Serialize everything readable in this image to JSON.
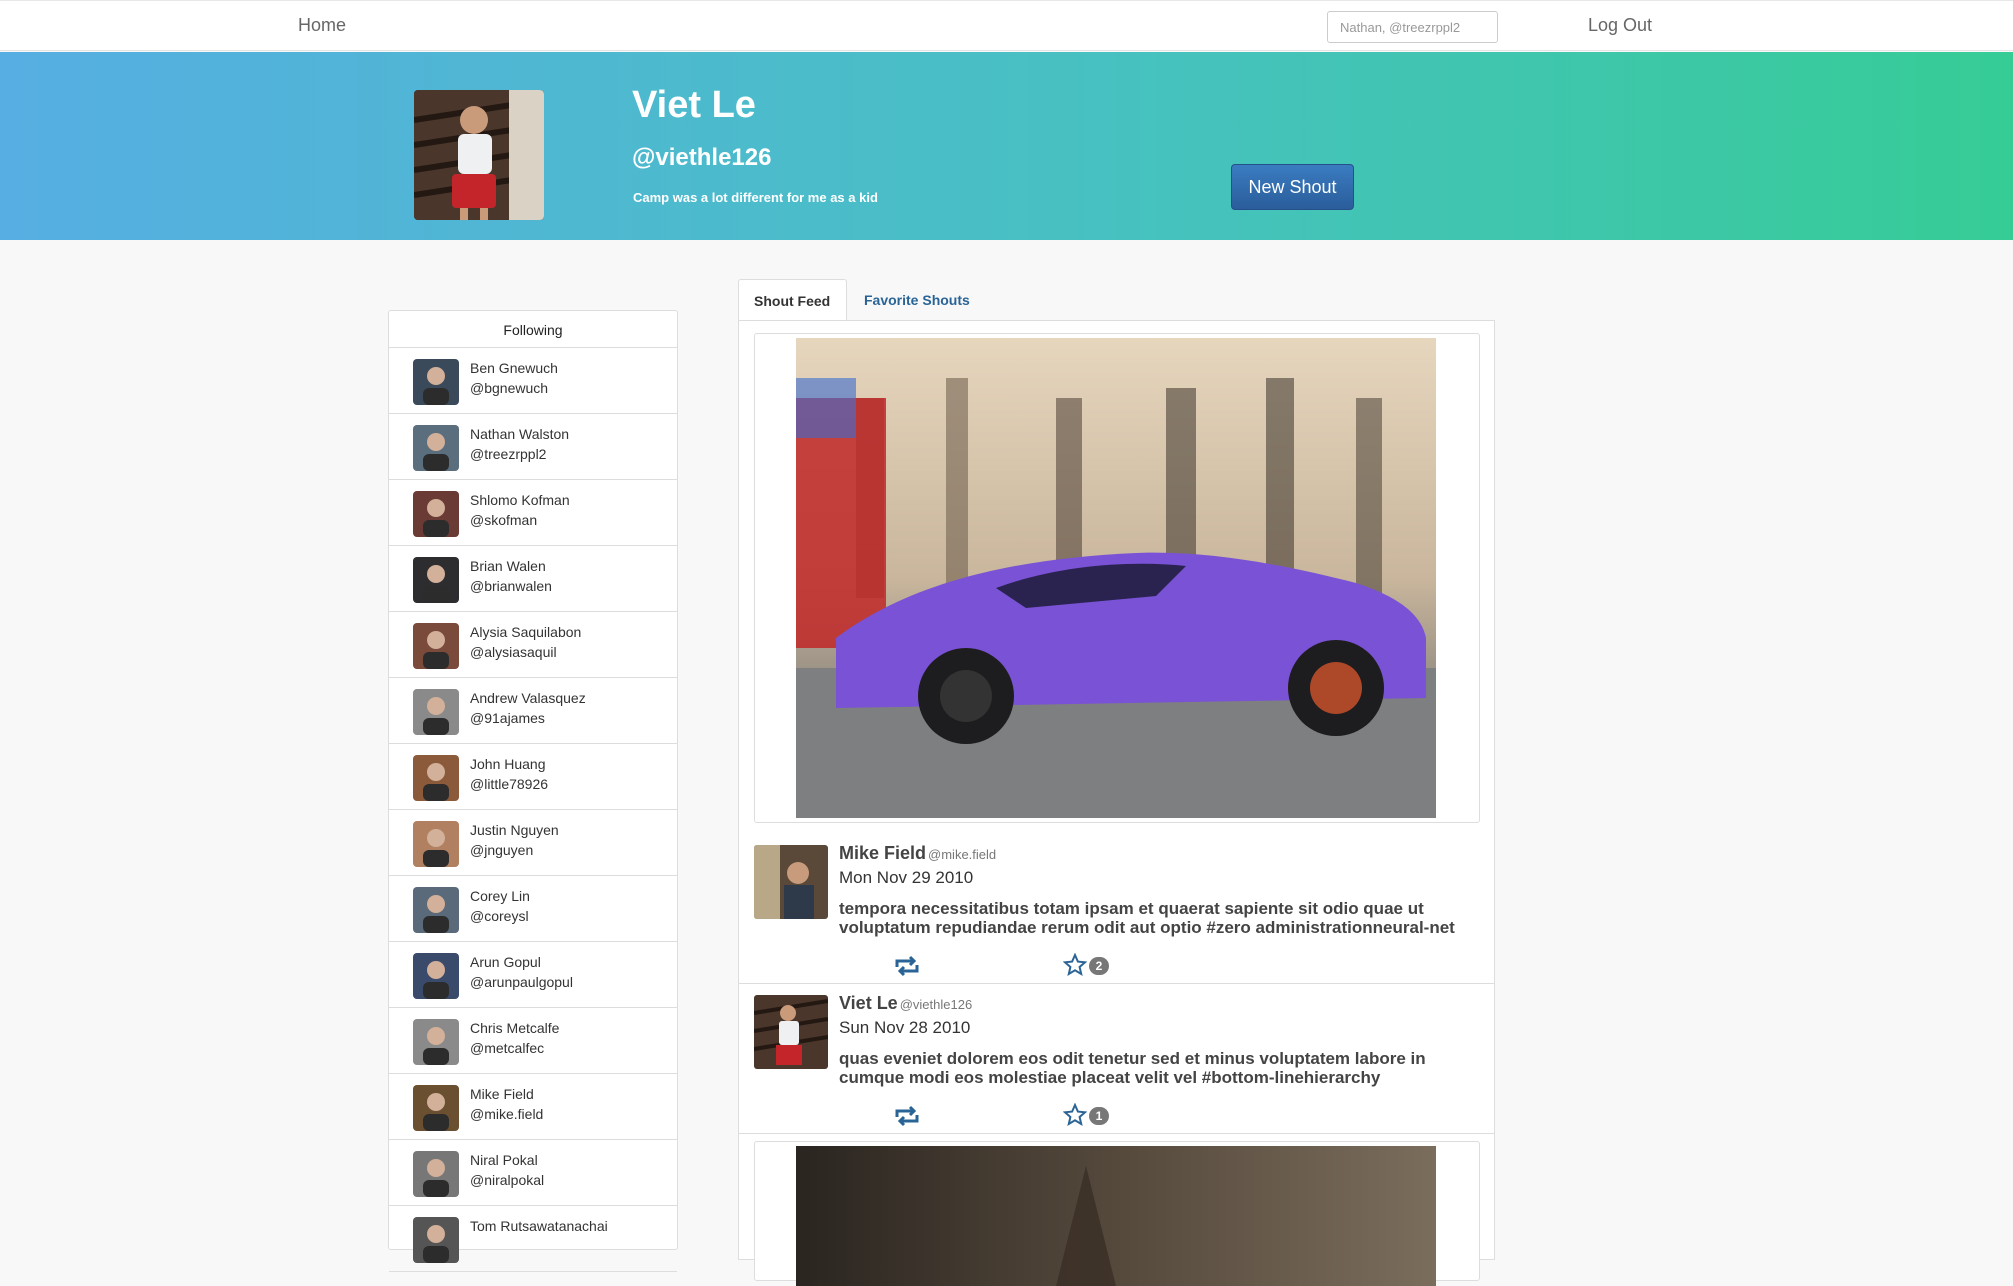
{
  "nav": {
    "home_label": "Home",
    "search_placeholder": "Nathan, @treezrppl2",
    "logout_label": "Log Out"
  },
  "profile": {
    "name": "Viet Le",
    "handle": "@viethle126",
    "bio": "Camp was a lot different for me as a kid",
    "new_shout_label": "New Shout"
  },
  "following": {
    "header": "Following",
    "items": [
      {
        "name": "Ben Gnewuch",
        "handle": "@bgnewuch"
      },
      {
        "name": "Nathan Walston",
        "handle": "@treezrppl2"
      },
      {
        "name": "Shlomo Kofman",
        "handle": "@skofman"
      },
      {
        "name": "Brian Walen",
        "handle": "@brianwalen"
      },
      {
        "name": "Alysia Saquilabon",
        "handle": "@alysiasaquil"
      },
      {
        "name": "Andrew Valasquez",
        "handle": "@91ajames"
      },
      {
        "name": "John Huang",
        "handle": "@little78926"
      },
      {
        "name": "Justin Nguyen",
        "handle": "@jnguyen"
      },
      {
        "name": "Corey Lin",
        "handle": "@coreysl"
      },
      {
        "name": "Arun Gopul",
        "handle": "@arunpaulgopul"
      },
      {
        "name": "Chris Metcalfe",
        "handle": "@metcalfec"
      },
      {
        "name": "Mike Field",
        "handle": "@mike.field"
      },
      {
        "name": "Niral Pokal",
        "handle": "@niralpokal"
      },
      {
        "name": "Tom Rutsawatanachai",
        "handle": ""
      }
    ]
  },
  "tabs": {
    "feed_label": "Shout Feed",
    "favorites_label": "Favorite Shouts"
  },
  "shouts": [
    {
      "name": "Mike Field",
      "handle": "@mike.field",
      "date": "Mon Nov 29 2010",
      "text": "tempora necessitatibus totam ipsam et quaerat sapiente sit odio quae ut voluptatum repudiandae rerum odit aut optio #zero administrationneural-net",
      "favorites": "2"
    },
    {
      "name": "Viet Le",
      "handle": "@viethle126",
      "date": "Sun Nov 28 2010",
      "text": "quas eveniet dolorem eos odit tenetur sed et minus voluptatem labore in cumque modi eos molestiae placeat velit vel #bottom-linehierarchy",
      "favorites": "1"
    }
  ],
  "colors": {
    "hero_gradient_start": "#56aee2",
    "hero_gradient_end": "#36cc96",
    "link_blue": "#2a6496",
    "button_blue": "#2f6aad",
    "car_purple": "#7a52d6"
  }
}
